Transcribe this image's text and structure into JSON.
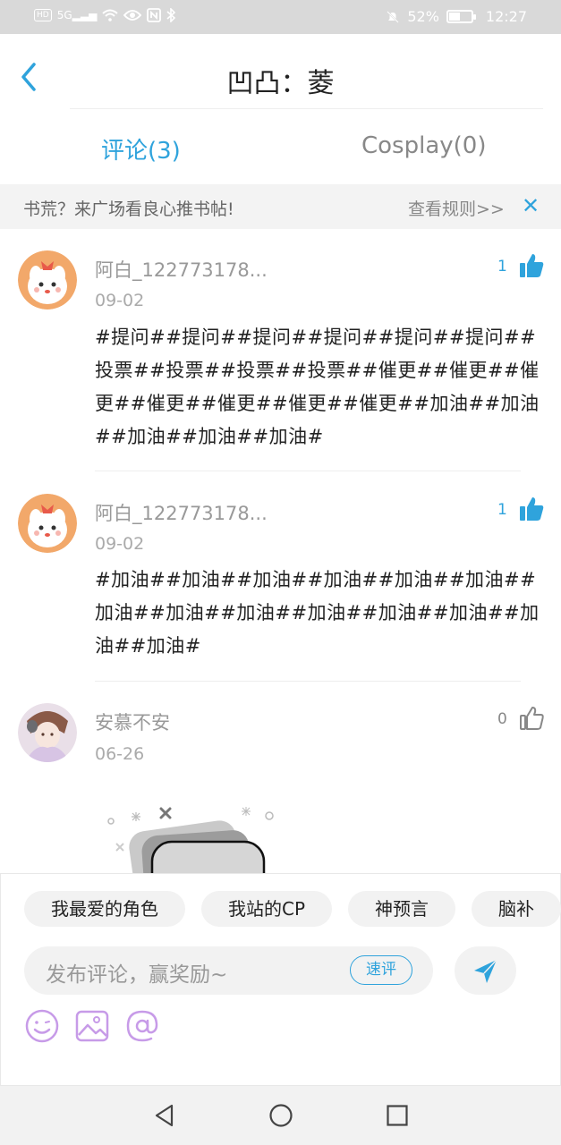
{
  "status_bar": {
    "left_chip": "HD",
    "signal_label": "5G",
    "battery": "52%",
    "battery_level": 0.52,
    "time": "12:27"
  },
  "header": {
    "title": "凹凸：菱",
    "back_icon": "chevron-left-icon"
  },
  "tabs": [
    {
      "label": "评论(3)",
      "active": true
    },
    {
      "label": "Cosplay(0)",
      "active": false
    }
  ],
  "notice": {
    "text": "书荒？来广场看良心推书帖!",
    "link": "查看规则>>",
    "close_icon": "close-icon"
  },
  "comments": [
    {
      "user": "阿白_122773178...",
      "date": "09-02",
      "text": "#提问##提问##提问##提问##提问##提问##投票##投票##投票##投票##催更##催更##催更##催更##催更##催更##催更##加油##加油##加油##加油##加油#",
      "likes": "1",
      "liked": true
    },
    {
      "user": "阿白_122773178...",
      "date": "09-02",
      "text": "#加油##加油##加油##加油##加油##加油##加油##加油##加油##加油##加油##加油##加油##加油#",
      "likes": "1",
      "liked": true
    },
    {
      "user": "安慕不安",
      "date": "06-26",
      "text": "",
      "likes": "0",
      "liked": false
    }
  ],
  "bottom": {
    "chips": [
      "我最爱的角色",
      "我站的CP",
      "神预言",
      "脑补"
    ],
    "input_placeholder": "发布评论，赢奖励~",
    "quick_review": "速评",
    "send_icon": "send-icon",
    "tools": [
      "emoji-icon",
      "image-icon",
      "mention-icon"
    ]
  },
  "navbar": [
    "back-triangle-icon",
    "home-circle-icon",
    "recents-square-icon"
  ],
  "colors": {
    "accent": "#2fa3dc",
    "tool_purple": "#c79be8",
    "statusbar": "#d9d9d9"
  }
}
